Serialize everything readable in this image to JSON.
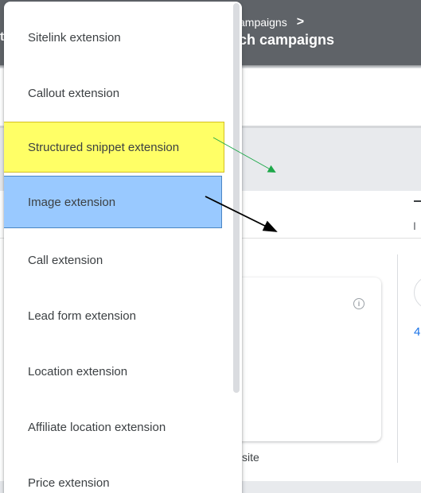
{
  "header": {
    "breadcrumb": "ampaigns",
    "breadcrumb_chevron": ">",
    "page_title": "ch campaigns",
    "left_peek": "t"
  },
  "background": {
    "right_tab_label": "I",
    "site_text": "site",
    "right_number": "4"
  },
  "dropdown": {
    "items": [
      {
        "label": "Sitelink extension"
      },
      {
        "label": "Callout extension"
      },
      {
        "label": "Structured snippet extension",
        "highlight": "yellow"
      },
      {
        "label": "Image extension",
        "highlight": "blue"
      },
      {
        "label": "Call extension"
      },
      {
        "label": "Lead form extension"
      },
      {
        "label": "Location extension"
      },
      {
        "label": "Affiliate location extension"
      },
      {
        "label": "Price extension"
      }
    ]
  },
  "annotations": {
    "green_arrow_color": "#1ea84a",
    "black_arrow_color": "#000000",
    "yellow_highlight": "#ffff66",
    "blue_highlight": "#99c9ff"
  },
  "icons": {
    "info": "info-icon",
    "chevron": "chevron-right-icon"
  }
}
